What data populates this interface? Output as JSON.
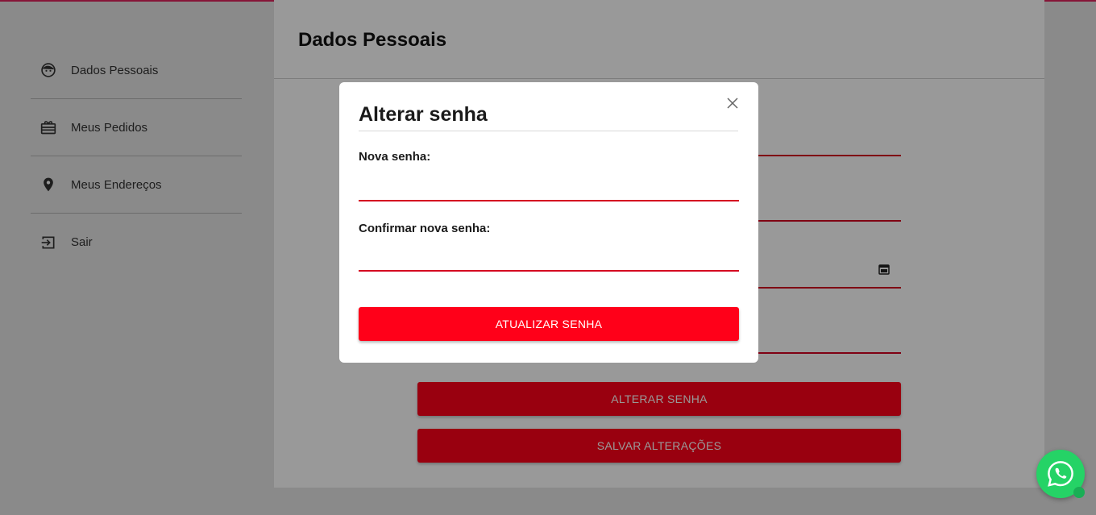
{
  "sidebar": {
    "items": [
      {
        "label": "Dados Pessoais",
        "icon": "face-icon"
      },
      {
        "label": "Meus Pedidos",
        "icon": "gift-box-icon"
      },
      {
        "label": "Meus Endereços",
        "icon": "location-pin-icon"
      },
      {
        "label": "Sair",
        "icon": "exit-icon"
      }
    ]
  },
  "main": {
    "title": "Dados Pessoais",
    "alterar_senha_label": "ALTERAR SENHA",
    "salvar_label": "SALVAR ALTERAÇÕES"
  },
  "modal": {
    "title": "Alterar senha",
    "nova_senha_label": "Nova senha:",
    "confirmar_label": "Confirmar nova senha:",
    "submit_label": "ATUALIZAR SENHA",
    "close_icon": "close-icon"
  },
  "colors": {
    "accent": "#ff0019",
    "underline": "#d40020",
    "top_accent": "#e0245e",
    "whatsapp": "#25d366"
  }
}
